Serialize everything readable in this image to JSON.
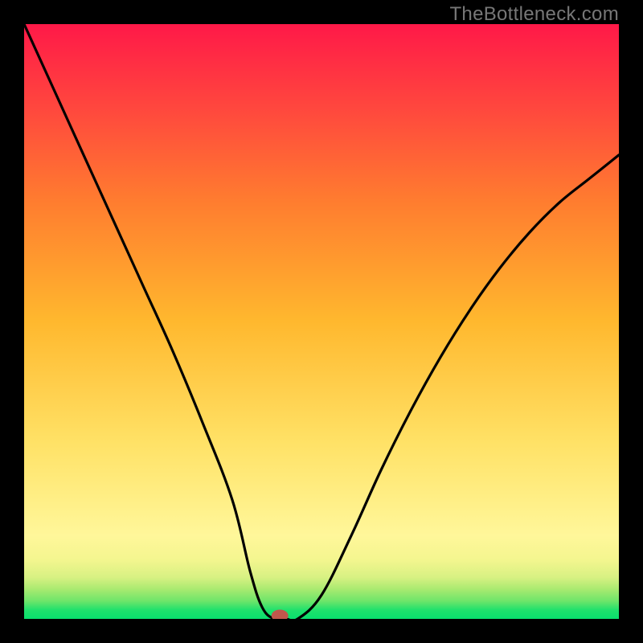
{
  "watermark": "TheBottleneck.com",
  "chart_data": {
    "type": "line",
    "title": "",
    "xlabel": "",
    "ylabel": "",
    "xlim": [
      0,
      100
    ],
    "ylim": [
      0,
      100
    ],
    "x": [
      0,
      5,
      10,
      15,
      20,
      25,
      30,
      35,
      38,
      40,
      42,
      44,
      46,
      50,
      55,
      60,
      65,
      70,
      75,
      80,
      85,
      90,
      95,
      100
    ],
    "values": [
      100,
      89,
      78,
      67,
      56,
      45,
      33,
      20,
      8,
      2,
      0,
      0,
      0,
      4,
      14,
      25,
      35,
      44,
      52,
      59,
      65,
      70,
      74,
      78
    ],
    "marker": {
      "x": 43,
      "y": 0
    },
    "bands": [
      {
        "from": 0,
        "to": 2,
        "color": "#08df6d"
      },
      {
        "from": 2,
        "to": 5,
        "color": "#6ee56a"
      },
      {
        "from": 5,
        "to": 9,
        "color": "#c3ef7a"
      },
      {
        "from": 9,
        "to": 14,
        "color": "#f4f68f"
      },
      {
        "from": 14,
        "to": 58,
        "color_top": "#fff79a",
        "color_bot": "#ffb72e"
      },
      {
        "from": 58,
        "to": 100,
        "color_top": "#ffb72e",
        "color_bot": "#ff1948"
      }
    ]
  }
}
